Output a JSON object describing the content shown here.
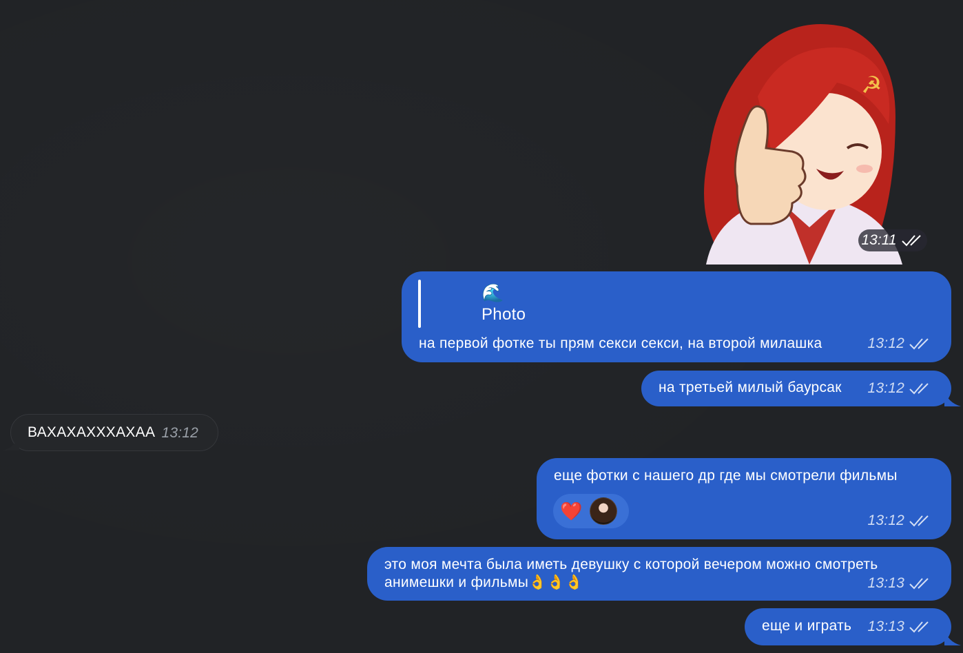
{
  "sticker": {
    "time": "13:11"
  },
  "messages": [
    {
      "reply_icon": "🌊",
      "reply_label": "Photo",
      "text": "на первой фотке ты прям секси секси, на второй милашка",
      "time": "13:12"
    },
    {
      "text": "на третьей милый баурсак",
      "time": "13:12"
    },
    {
      "text": "ВАХАХАХХХАХАА",
      "time": "13:12"
    },
    {
      "text": "еще фотки с нашего др где мы смотрели фильмы",
      "time": "13:12",
      "reaction": "❤️"
    },
    {
      "text_line1": "это моя мечта была иметь девушку с которой вечером можно смотреть",
      "text_line2": "анимешки и фильмы👌👌👌",
      "time": "13:13"
    },
    {
      "text": "еще и играть",
      "time": "13:13"
    }
  ],
  "colors": {
    "background": "#212326",
    "outgoing_bubble": "#2a5fc9",
    "incoming_bubble": "#25272a"
  }
}
